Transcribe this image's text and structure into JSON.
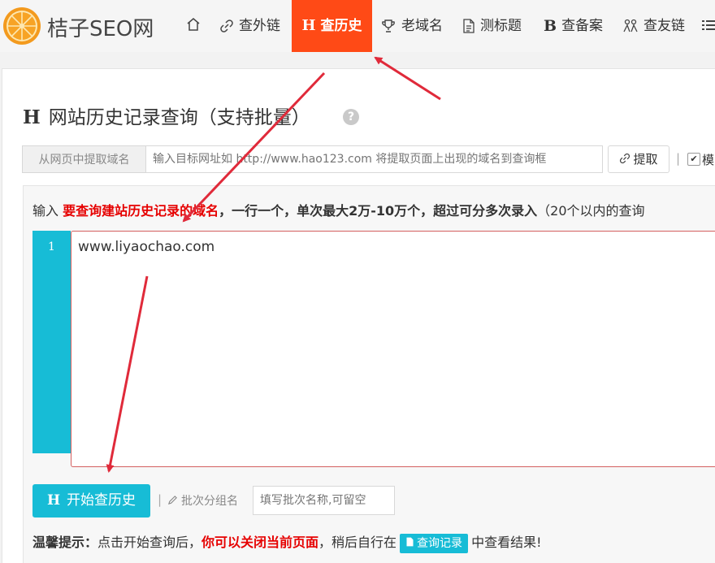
{
  "brand": {
    "name": "桔子SEO网"
  },
  "nav": {
    "items": [
      {
        "label": "",
        "icon": "home-icon"
      },
      {
        "label": "查外链",
        "icon": "link-icon"
      },
      {
        "label": "查历史",
        "icon": "h-icon",
        "active": true
      },
      {
        "label": "老域名",
        "icon": "trophy-icon"
      },
      {
        "label": "测标题",
        "icon": "document-icon"
      },
      {
        "label": "查备案",
        "icon": "b-icon"
      },
      {
        "label": "查友链",
        "icon": "people-icon"
      }
    ]
  },
  "page": {
    "title_mark": "H",
    "title": "网站历史记录查询（支持批量）",
    "help": "?"
  },
  "extract": {
    "label": "从网页中提取域名",
    "placeholder": "输入目标网址如 http://www.hao123.com 将提取页面上出现的域名到查询框",
    "button": "提取",
    "sep": "|",
    "model_label": "模"
  },
  "instruction": {
    "prefix": "输入 ",
    "highlight": "要查询建站历史记录的域名",
    "bold": "，一行一个，单次最大2万-10万个，超过可分多次录入",
    "suffix": "（20个以内的查询"
  },
  "editor": {
    "line_number": "1",
    "content": "www.liyaochao.com"
  },
  "actions": {
    "start_mark": "H",
    "start_label": "开始查历史",
    "sep": "|",
    "group_label": "批次分组名",
    "group_placeholder": "填写批次名称,可留空"
  },
  "tip": {
    "label": "温馨提示：",
    "text1": "点击开始查询后，",
    "highlight": "你可以关闭当前页面",
    "text2": "，稍后自行在",
    "button": "查询记录",
    "text3": "中查看结果!"
  },
  "colors": {
    "accent": "#ff4a16",
    "teal": "#17bcd6",
    "red": "#e60000",
    "arrow": "#e02a3a"
  }
}
